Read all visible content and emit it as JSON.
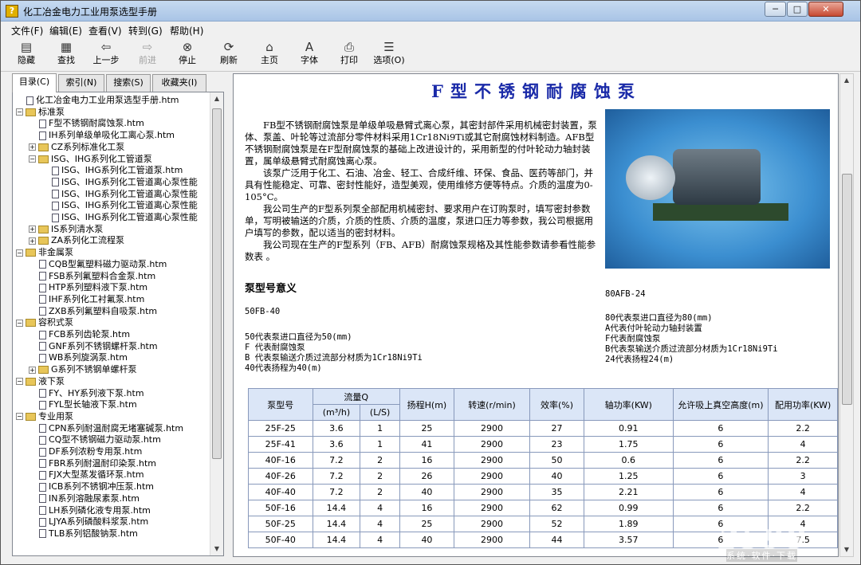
{
  "window": {
    "title": "化工冶金电力工业用泵选型手册",
    "min": "─",
    "max": "□",
    "close": "✕"
  },
  "menu": [
    "文件(F)",
    "编辑(E)",
    "查看(V)",
    "转到(G)",
    "帮助(H)"
  ],
  "toolbar": [
    {
      "label": "隐藏",
      "icon": "hide-icon",
      "glyph": "▤",
      "enabled": true
    },
    {
      "label": "查找",
      "icon": "find-icon",
      "glyph": "▦",
      "enabled": true
    },
    {
      "label": "上一步",
      "icon": "back-icon",
      "glyph": "⇦",
      "enabled": true
    },
    {
      "label": "前进",
      "icon": "forward-icon",
      "glyph": "⇨",
      "enabled": false
    },
    {
      "label": "停止",
      "icon": "stop-icon",
      "glyph": "⊗",
      "enabled": true
    },
    {
      "label": "刷新",
      "icon": "refresh-icon",
      "glyph": "⟳",
      "enabled": true
    },
    {
      "label": "主页",
      "icon": "home-icon",
      "glyph": "⌂",
      "enabled": true
    },
    {
      "label": "字体",
      "icon": "font-icon",
      "glyph": "A",
      "enabled": true
    },
    {
      "label": "打印",
      "icon": "print-icon",
      "glyph": "⎙",
      "enabled": true
    },
    {
      "label": "选项(O)",
      "icon": "options-icon",
      "glyph": "☰",
      "enabled": true
    }
  ],
  "tabs": [
    "目录(C)",
    "索引(N)",
    "搜索(S)",
    "收藏夹(I)"
  ],
  "tree": [
    {
      "indent": 0,
      "type": "doc",
      "label": "化工冶金电力工业用泵选型手册.htm"
    },
    {
      "indent": 0,
      "type": "folder",
      "exp": "−",
      "label": "标准泵"
    },
    {
      "indent": 1,
      "type": "doc",
      "label": "F型不锈钢耐腐蚀泵.htm"
    },
    {
      "indent": 1,
      "type": "doc",
      "label": "IH系列单级单吸化工离心泵.htm"
    },
    {
      "indent": 1,
      "type": "folder",
      "exp": "+",
      "label": "CZ系列标准化工泵"
    },
    {
      "indent": 1,
      "type": "folder",
      "exp": "−",
      "label": "ISG、IHG系列化工管道泵"
    },
    {
      "indent": 2,
      "type": "doc",
      "label": "ISG、IHG系列化工管道泵.htm"
    },
    {
      "indent": 2,
      "type": "doc",
      "label": "ISG、IHG系列化工管道离心泵性能"
    },
    {
      "indent": 2,
      "type": "doc",
      "label": "ISG、IHG系列化工管道离心泵性能"
    },
    {
      "indent": 2,
      "type": "doc",
      "label": "ISG、IHG系列化工管道离心泵性能"
    },
    {
      "indent": 2,
      "type": "doc",
      "label": "ISG、IHG系列化工管道离心泵性能"
    },
    {
      "indent": 1,
      "type": "folder",
      "exp": "+",
      "label": "IS系列清水泵"
    },
    {
      "indent": 1,
      "type": "folder",
      "exp": "+",
      "label": "ZA系列化工流程泵"
    },
    {
      "indent": 0,
      "type": "folder",
      "exp": "−",
      "label": "非金属泵"
    },
    {
      "indent": 1,
      "type": "doc",
      "label": "CQB型氟塑料磁力驱动泵.htm"
    },
    {
      "indent": 1,
      "type": "doc",
      "label": "FSB系列氟塑料合金泵.htm"
    },
    {
      "indent": 1,
      "type": "doc",
      "label": "HTP系列塑料液下泵.htm"
    },
    {
      "indent": 1,
      "type": "doc",
      "label": "IHF系列化工衬氟泵.htm"
    },
    {
      "indent": 1,
      "type": "doc",
      "label": "ZXB系列氟塑料自吸泵.htm"
    },
    {
      "indent": 0,
      "type": "folder",
      "exp": "−",
      "label": "容积式泵"
    },
    {
      "indent": 1,
      "type": "doc",
      "label": "FCB系列齿轮泵.htm"
    },
    {
      "indent": 1,
      "type": "doc",
      "label": "GNF系列不锈钢螺杆泵.htm"
    },
    {
      "indent": 1,
      "type": "doc",
      "label": "WB系列旋涡泵.htm"
    },
    {
      "indent": 1,
      "type": "folder",
      "exp": "+",
      "label": "G系列不锈钢单螺杆泵"
    },
    {
      "indent": 0,
      "type": "folder",
      "exp": "−",
      "label": "液下泵"
    },
    {
      "indent": 1,
      "type": "doc",
      "label": "FY、HY系列液下泵.htm"
    },
    {
      "indent": 1,
      "type": "doc",
      "label": "FYL型长轴液下泵.htm"
    },
    {
      "indent": 0,
      "type": "folder",
      "exp": "−",
      "label": "专业用泵"
    },
    {
      "indent": 1,
      "type": "doc",
      "label": "CPN系列耐温耐腐无堵塞碱泵.htm"
    },
    {
      "indent": 1,
      "type": "doc",
      "label": "CQ型不锈钢磁力驱动泵.htm"
    },
    {
      "indent": 1,
      "type": "doc",
      "label": "DF系列浓粉专用泵.htm"
    },
    {
      "indent": 1,
      "type": "doc",
      "label": "FBR系列耐温耐印染泵.htm"
    },
    {
      "indent": 1,
      "type": "doc",
      "label": "FJX大型蒸发循环泵.htm"
    },
    {
      "indent": 1,
      "type": "doc",
      "label": "ICB系列不锈钢冲压泵.htm"
    },
    {
      "indent": 1,
      "type": "doc",
      "label": "IN系列溶融尿素泵.htm"
    },
    {
      "indent": 1,
      "type": "doc",
      "label": "LH系列磷化液专用泵.htm"
    },
    {
      "indent": 1,
      "type": "doc",
      "label": "LJYA系列磷酸料浆泵.htm"
    },
    {
      "indent": 1,
      "type": "doc",
      "label": "TLB系列铝酸钠泵.htm"
    }
  ],
  "content": {
    "title": "F型不锈钢耐腐蚀泵",
    "intro": [
      "FB型不锈钢耐腐蚀泵是单级单吸悬臂式离心泵，其密封部件采用机械密封装置，泵体、泵盖、叶轮等过流部分零件材料采用1Cr18Ni9Ti或其它耐腐蚀材料制造。AFB型不锈钢耐腐蚀泵是在F型耐腐蚀泵的基础上改进设计的，采用新型的付叶轮动力轴封装置，属单级悬臂式耐腐蚀离心泵。",
      "该泵广泛用于化工、石油、冶金、轻工、合成纤维、环保、食品、医药等部门，并具有性能稳定、可靠、密封性能好，造型美观，使用维修方便等特点。介质的温度为0-105°C。",
      "我公司生产的F型系列泵全部配用机械密封、要求用户在订购泵时，填写密封参数单，写明被输送的介质，介质的性质、介质的温度，泵进口压力等参数，我公司根据用户填写的参数，配以适当的密封材料。",
      "我公司现在生产的F型系列（FB、AFB）耐腐蚀泵规格及其性能参数请参看性能参数表 。"
    ],
    "section_title": "泵型号意义",
    "example1": {
      "code": "50FB-40",
      "lines": [
        "50代表泵进口直径为50(mm)",
        "F 代表耐腐蚀泵",
        "B 代表泵输送介质过流部分材质为1Cr18Ni9Ti",
        "40代表扬程为40(m)"
      ]
    },
    "example2": {
      "code": "80AFB-24",
      "lines": [
        "80代表泵进口直径为80(mm)",
        "A代表付叶轮动力轴封装置",
        "F代表耐腐蚀泵",
        "B代表泵输送介质过流部分材质为1Cr18Ni9Ti",
        "24代表扬程24(m)"
      ]
    },
    "table": {
      "head": [
        "泵型号",
        "流量Q",
        "扬程H(m)",
        "转速(r/min)",
        "效率(%)",
        "轴功率(KW)",
        "允许吸上真空高度(m)",
        "配用功率(KW)"
      ],
      "flow_units": [
        "(m³/h)",
        "(L/S)"
      ],
      "rows": [
        [
          "25F-25",
          "3.6",
          "1",
          "25",
          "2900",
          "27",
          "0.91",
          "6",
          "2.2"
        ],
        [
          "25F-41",
          "3.6",
          "1",
          "41",
          "2900",
          "23",
          "1.75",
          "6",
          "4"
        ],
        [
          "40F-16",
          "7.2",
          "2",
          "16",
          "2900",
          "50",
          "0.6",
          "6",
          "2.2"
        ],
        [
          "40F-26",
          "7.2",
          "2",
          "26",
          "2900",
          "40",
          "1.25",
          "6",
          "3"
        ],
        [
          "40F-40",
          "7.2",
          "2",
          "40",
          "2900",
          "35",
          "2.21",
          "6",
          "4"
        ],
        [
          "50F-16",
          "14.4",
          "4",
          "16",
          "2900",
          "62",
          "0.99",
          "6",
          "2.2"
        ],
        [
          "50F-25",
          "14.4",
          "4",
          "25",
          "2900",
          "52",
          "1.89",
          "6",
          "4"
        ],
        [
          "50F-40",
          "14.4",
          "4",
          "40",
          "2900",
          "44",
          "3.57",
          "6",
          "7.5"
        ]
      ]
    }
  },
  "watermark": {
    "main": "2598",
    "sub": "系统·软件·下载"
  }
}
